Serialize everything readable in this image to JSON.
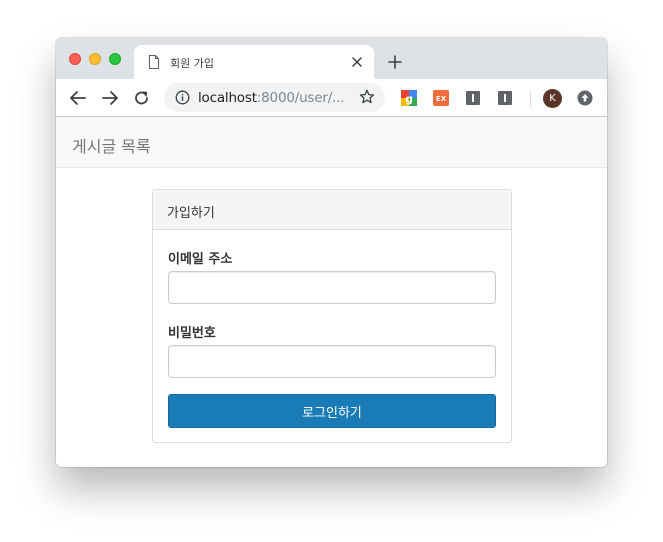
{
  "browser": {
    "tab": {
      "title": "회원 가입"
    },
    "address_bar": {
      "host": "localhost",
      "path": ":8000/user/..."
    },
    "profile_initial": "K",
    "colors": {
      "tabstrip": "#dee1e6",
      "omnibox": "#f1f3f4"
    },
    "icons": [
      "back-arrow-icon",
      "forward-arrow-icon",
      "reload-icon",
      "info-icon",
      "star-icon",
      "google-extension-icon",
      "ex-extension-icon",
      "bookmark-extension-icon",
      "update-icon"
    ]
  },
  "page": {
    "navbar": {
      "brand": "게시글 목록"
    },
    "panel": {
      "heading": "가입하기",
      "email_label": "이메일 주소",
      "email_value": "",
      "password_label": "비밀번호",
      "password_value": "",
      "submit_label": "로그인하기"
    },
    "colors": {
      "primary_button": "#1a7cb6",
      "navbar": "#f8f8f8"
    }
  }
}
